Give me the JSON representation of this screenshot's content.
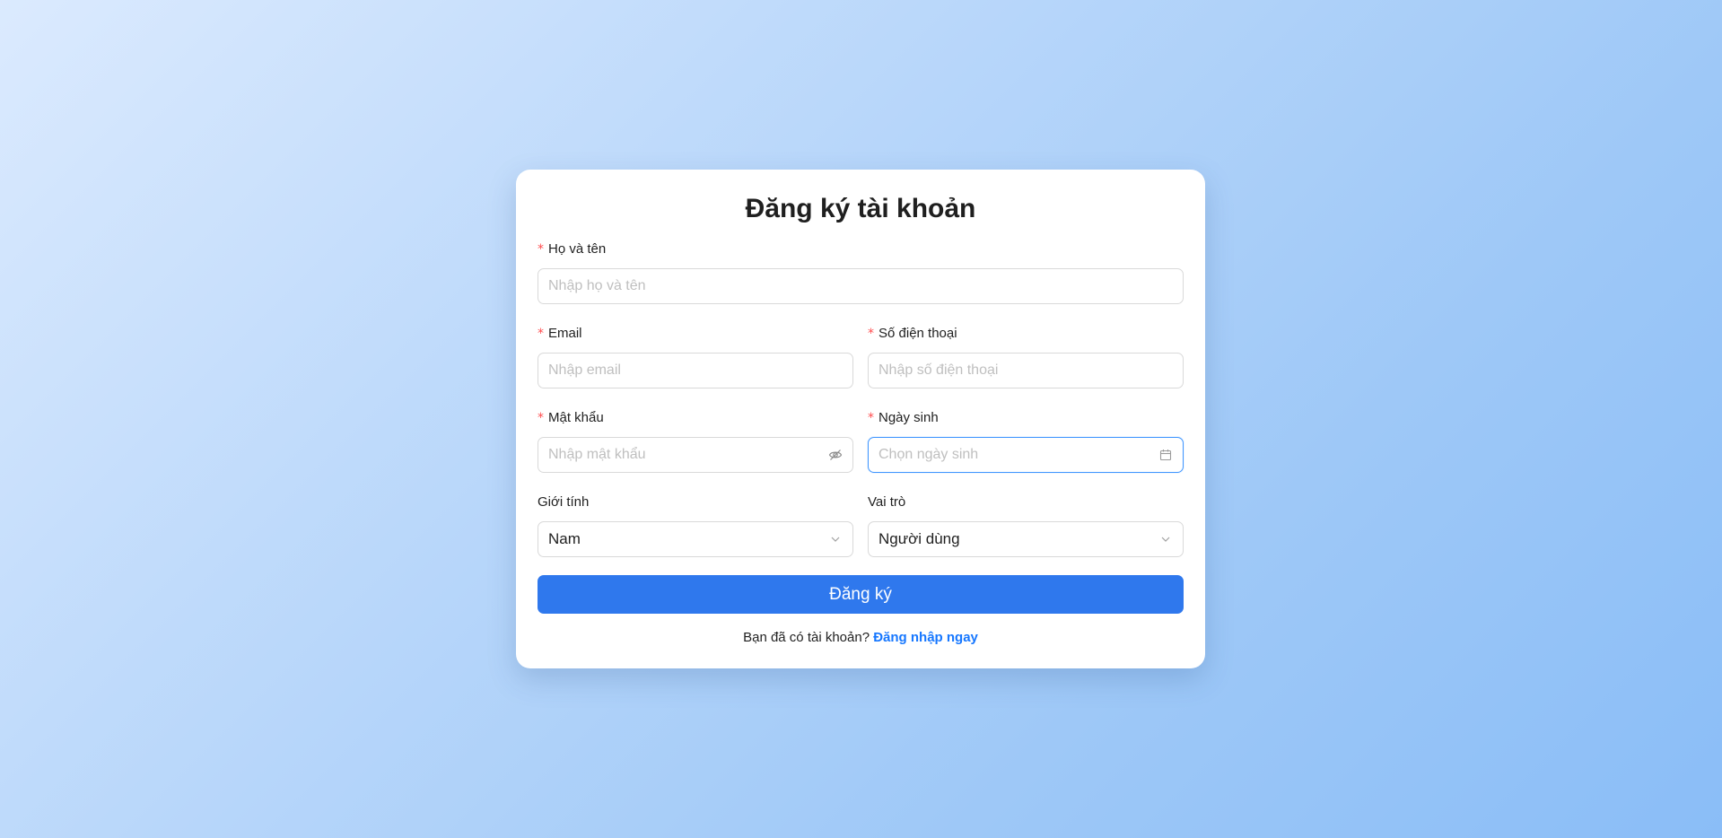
{
  "form": {
    "title": "Đăng ký tài khoản",
    "required_mark": "*",
    "fullname": {
      "label": "Họ và tên",
      "placeholder": "Nhập họ và tên"
    },
    "email": {
      "label": "Email",
      "placeholder": "Nhập email"
    },
    "phone": {
      "label": "Số điện thoại",
      "placeholder": "Nhập số điện thoại"
    },
    "password": {
      "label": "Mật khẩu",
      "placeholder": "Nhập mật khẩu",
      "icon": "eye-invisible-icon"
    },
    "birthday": {
      "label": "Ngày sinh",
      "placeholder": "Chọn ngày sinh",
      "icon": "calendar-icon"
    },
    "gender": {
      "label": "Giới tính",
      "value": "Nam",
      "icon": "chevron-down-icon"
    },
    "role": {
      "label": "Vai trò",
      "value": "Người dùng",
      "icon": "chevron-down-icon"
    },
    "submit_label": "Đăng ký",
    "footer_text": "Bạn đã có tài khoản?",
    "footer_link": "Đăng nhập ngay"
  },
  "colors": {
    "primary": "#2f78ed",
    "link": "#1677ff",
    "required": "#ff4d4f",
    "focus_border": "#4096ff"
  }
}
